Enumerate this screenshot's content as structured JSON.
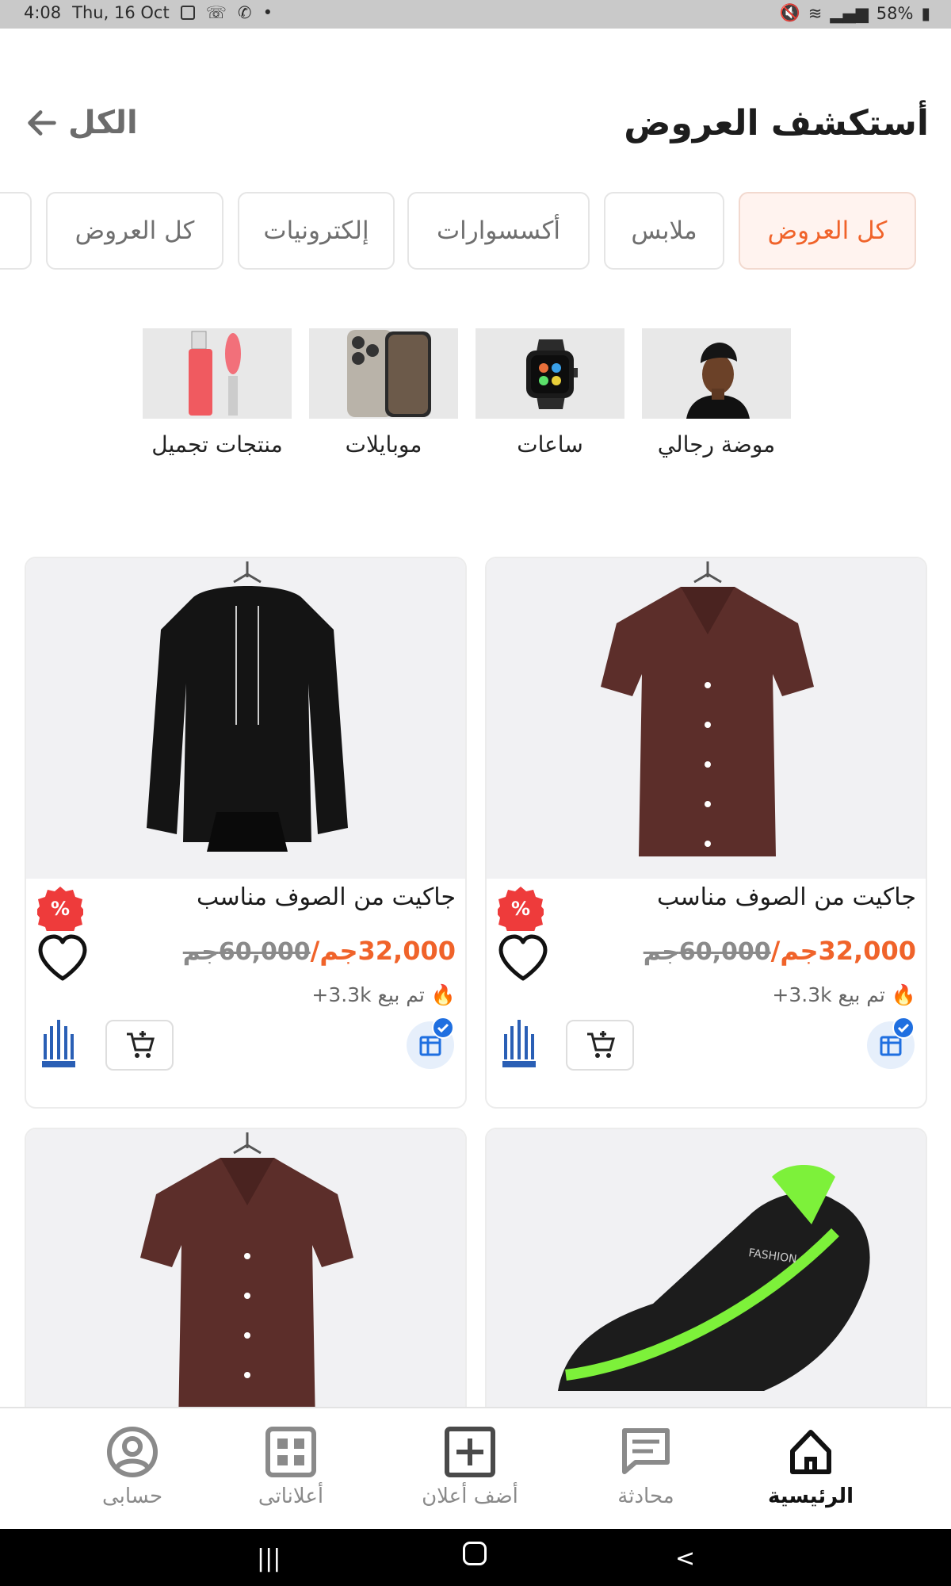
{
  "status_bar": {
    "time": "4:08",
    "date": "Thu, 16 Oct",
    "battery": "58%"
  },
  "header": {
    "title": "أستكشف العروض",
    "see_all": "الكل"
  },
  "chips": [
    {
      "label": "كل العروض",
      "active": true
    },
    {
      "label": "ملابس",
      "active": false
    },
    {
      "label": "أكسسوارات",
      "active": false
    },
    {
      "label": "إلكترونيات",
      "active": false
    },
    {
      "label": "كل العروض",
      "active": false
    }
  ],
  "categories": [
    {
      "label": "موضة رجالي",
      "icon": "man-portrait-image"
    },
    {
      "label": "ساعات",
      "icon": "smartwatch-image"
    },
    {
      "label": "موبايلات",
      "icon": "phone-image"
    },
    {
      "label": "منتجات تجميل",
      "icon": "lip-gloss-image"
    }
  ],
  "products": [
    {
      "name": "جاكيت من الصوف مناسب",
      "price": "32,000جم/",
      "old_price": "60,000جم",
      "sold": "تم بيع 3.3k+",
      "image": "brown-shirt"
    },
    {
      "name": "جاكيت من الصوف مناسب",
      "price": "32,000جم/",
      "old_price": "60,000جم",
      "sold": "تم بيع 3.3k+",
      "image": "black-hoodie"
    },
    {
      "name": "",
      "image": "sneaker"
    },
    {
      "name": "",
      "image": "brown-shirt"
    }
  ],
  "nav": {
    "home": "الرئيسية",
    "chat": "محادثة",
    "add": "أضف أعلان",
    "my_ads": "أعلاناتى",
    "account": "حسابى"
  },
  "colors": {
    "accent": "#f0632a",
    "verify": "#1f6fe0"
  }
}
